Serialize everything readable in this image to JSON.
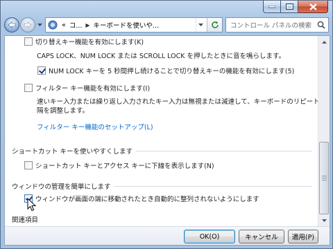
{
  "window": {
    "caption_buttons": [
      "minimize-icon",
      "maximize-icon",
      "close-icon"
    ]
  },
  "nav": {
    "crumb_prefix": "«",
    "crumbs": [
      "コ...",
      "キーボードを使いや..."
    ],
    "search_placeholder": "コントロール パネルの検索"
  },
  "sections": {
    "toggle_keys": {
      "checkbox_label": "切り替えキー機能を有効にします(K)",
      "description": "CAPS LOCK、NUM LOCK または SCROLL LOCK を押したときに音を鳴らします。",
      "sub_checkbox_label": "NUM LOCK キーを 5 秒間押し続けることで切り替えキーの機能を有効にします(5)",
      "sub_checked": true,
      "checked": false
    },
    "filter_keys": {
      "checkbox_label": "フィルター キー機能を有効にします(I)",
      "description_line1": "速いキー入力または繰り返し入力されたキー入力は無視または減速して、キーボードのリピート間",
      "description_line2": "隔を調整します。",
      "setup_link": "フィルター キー機能のセットアップ(L)",
      "checked": false
    },
    "shortcuts": {
      "heading": "ショートカット キーを使いやすくします",
      "checkbox_label": "ショートカット キーとアクセス キーに下線を表示します(N)",
      "checked": false
    },
    "window_management": {
      "heading": "ウィンドウの管理を簡単にします",
      "checkbox_label": "ウィンドウが画面の端に移動されたとき自動的に整列されないようにします",
      "checked": true
    },
    "related": {
      "heading": "関連項目"
    }
  },
  "buttons": {
    "ok": "OK(O)",
    "cancel": "キャンセル",
    "apply": "適用(P)"
  }
}
